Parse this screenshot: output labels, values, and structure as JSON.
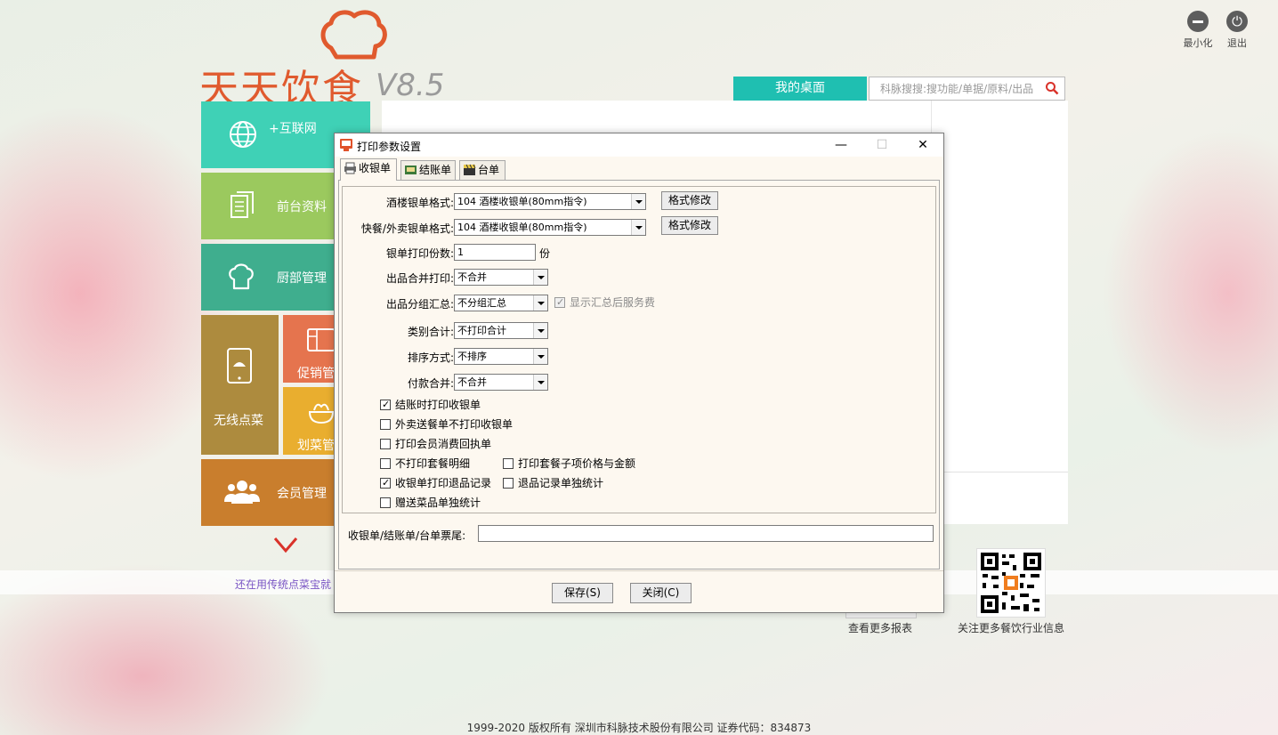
{
  "app": {
    "logo_text": "天天饮食",
    "version": "V8.5",
    "minimize_label": "最小化",
    "exit_label": "退出",
    "desktop_tab": "我的桌面",
    "search_placeholder": "科脉搜搜:搜功能/单据/原料/出品"
  },
  "tiles": {
    "internet": "+互联网",
    "front": "前台资料",
    "kitchen": "厨部管理",
    "wireless": "无线点菜",
    "promo": "促销管",
    "dish": "划菜管",
    "member": "会员管理"
  },
  "strip_text": "还在用传统点菜宝就",
  "reports_caption": "查看更多报表",
  "qr_caption": "关注更多餐饮行业信息",
  "footer": "1999-2020  版权所有  深圳市科脉技术股份有限公司  证券代码：834873",
  "dialog": {
    "title": "打印参数设置",
    "tabs": [
      "收银单",
      "结账单",
      "台单"
    ],
    "fields": {
      "restaurant_format_label": "酒楼银单格式:",
      "restaurant_format_value": "104  酒楼收银单(80mm指令)",
      "fastfood_format_label": "快餐/外卖银单格式:",
      "fastfood_format_value": "104  酒楼收银单(80mm指令)",
      "format_edit": "格式修改",
      "copies_label": "银单打印份数:",
      "copies_value": "1",
      "copies_unit": "份",
      "merge_label": "出品合并打印:",
      "merge_value": "不合并",
      "group_label": "出品分组汇总:",
      "group_value": "不分组汇总",
      "show_service_fee": "显示汇总后服务费",
      "category_label": "类别合计:",
      "category_value": "不打印合计",
      "sort_label": "排序方式:",
      "sort_value": "不排序",
      "payment_label": "付款合并:",
      "payment_value": "不合并",
      "footer_label": "收银单/结账单/台单票尾:",
      "footer_value": ""
    },
    "checkboxes": {
      "print_on_checkout": "结账时打印收银单",
      "no_print_delivery": "外卖送餐单不打印收银单",
      "print_member_receipt": "打印会员消费回执单",
      "no_print_set_detail": "不打印套餐明细",
      "print_set_sub_price": "打印套餐子项价格与金额",
      "print_return_record": "收银单打印退品记录",
      "return_record_separate": "退品记录单独统计",
      "gift_separate": "赠送菜品单独统计"
    },
    "buttons": {
      "save": "保存(S)",
      "close": "关闭(C)"
    }
  }
}
